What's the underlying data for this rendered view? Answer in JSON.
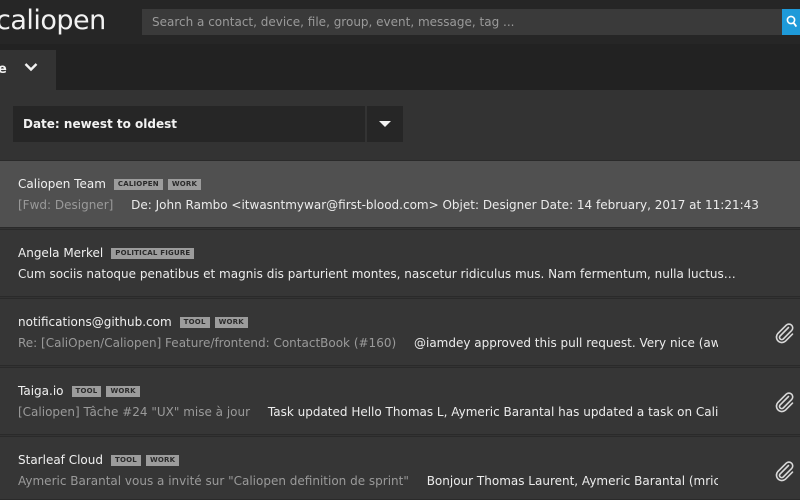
{
  "app": {
    "logo": "caliopen"
  },
  "search": {
    "placeholder": "Search a contact, device, file, group, event, message, tag ..."
  },
  "tabs": [
    {
      "label": "e"
    }
  ],
  "sort": {
    "label": "Date: newest to oldest"
  },
  "colors": {
    "accent": "#1e9ad9",
    "selected_row": "#505050",
    "tag_bg": "#9c9c9c"
  },
  "messages": [
    {
      "sender": "Caliopen Team",
      "tags": [
        "CALIOPEN",
        "WORK"
      ],
      "subject": "[Fwd: Designer]",
      "excerpt": "De: John Rambo <itwasntmywar@first-blood.com> Objet: Designer Date: 14 february, 2017 at 11:21:43…",
      "attachment": false,
      "selected": true
    },
    {
      "sender": "Angela Merkel",
      "tags": [
        "POLITICAL FIGURE"
      ],
      "subject": "",
      "excerpt": "Cum sociis natoque penatibus et magnis dis parturient montes, nascetur ridiculus mus.  Nam fermentum, nulla luctus…",
      "attachment": false,
      "selected": false
    },
    {
      "sender": "notifications@github.com",
      "tags": [
        "TOOL",
        "WORK"
      ],
      "subject": "Re: [CaliOpen/Caliopen] Feature/frontend: ContactBook (#160)",
      "excerpt": "@iamdey approved this pull request. Very nice (aweso…",
      "attachment": true,
      "selected": false
    },
    {
      "sender": "Taiga.io",
      "tags": [
        "TOOL",
        "WORK"
      ],
      "subject": "[Caliopen] Tâche #24 \"UX\" mise à jour",
      "excerpt": "Task updated Hello Thomas L, Aymeric Barantal has updated a task on Caliope…",
      "attachment": true,
      "selected": false
    },
    {
      "sender": "Starleaf Cloud",
      "tags": [
        "TOOL",
        "WORK"
      ],
      "subject": "Aymeric Barantal vous a invité sur \"Caliopen definition de sprint\"",
      "excerpt": "Bonjour Thomas Laurent, Aymeric Barantal (mric@g…",
      "attachment": true,
      "selected": false
    }
  ]
}
